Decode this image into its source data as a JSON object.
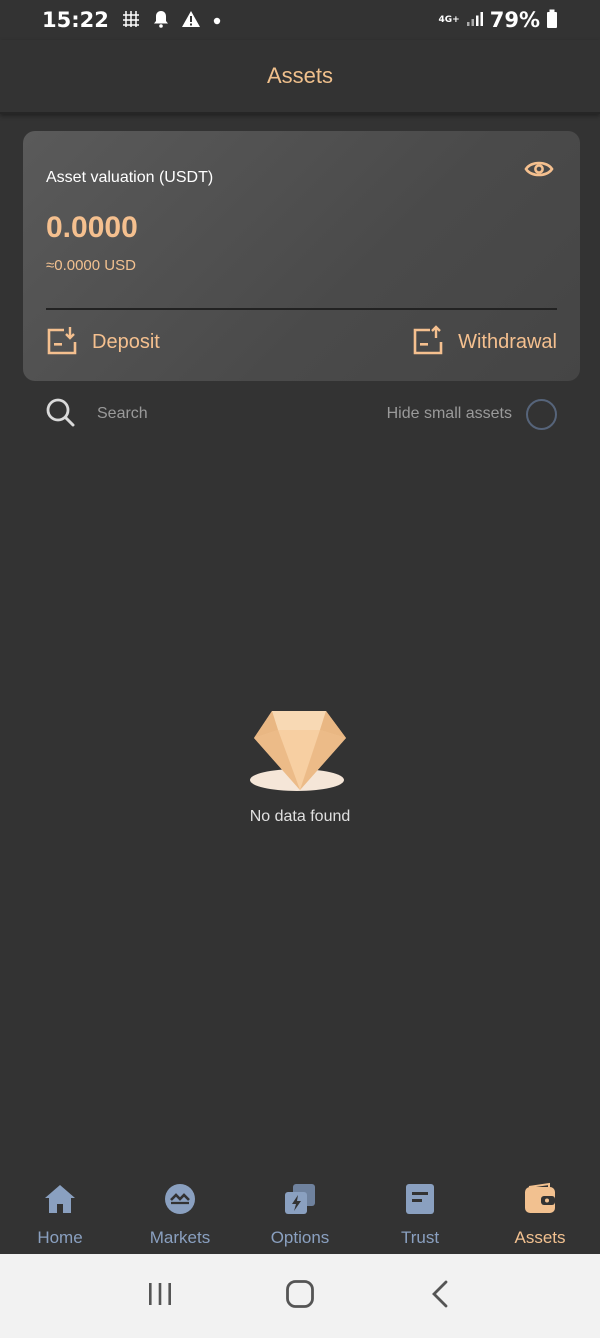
{
  "status_bar": {
    "time": "15:22",
    "network": "4G+",
    "battery": "79%"
  },
  "header": {
    "title": "Assets"
  },
  "valuation": {
    "label": "Asset valuation (USDT)",
    "amount": "0.0000",
    "usd_equivalent": "≈0.0000 USD",
    "deposit_label": "Deposit",
    "withdrawal_label": "Withdrawal"
  },
  "filters": {
    "search_placeholder": "Search",
    "hide_small_label": "Hide small assets",
    "hide_small_checked": false
  },
  "empty_state": {
    "text": "No data found"
  },
  "bottom_nav": {
    "items": [
      {
        "label": "Home",
        "icon": "home-icon",
        "active": false
      },
      {
        "label": "Markets",
        "icon": "markets-icon",
        "active": false
      },
      {
        "label": "Options",
        "icon": "options-icon",
        "active": false
      },
      {
        "label": "Trust",
        "icon": "trust-icon",
        "active": false
      },
      {
        "label": "Assets",
        "icon": "wallet-icon",
        "active": true
      }
    ]
  },
  "colors": {
    "accent": "#f5c08f",
    "inactive_nav": "#8aa0c0",
    "background": "#333333"
  }
}
